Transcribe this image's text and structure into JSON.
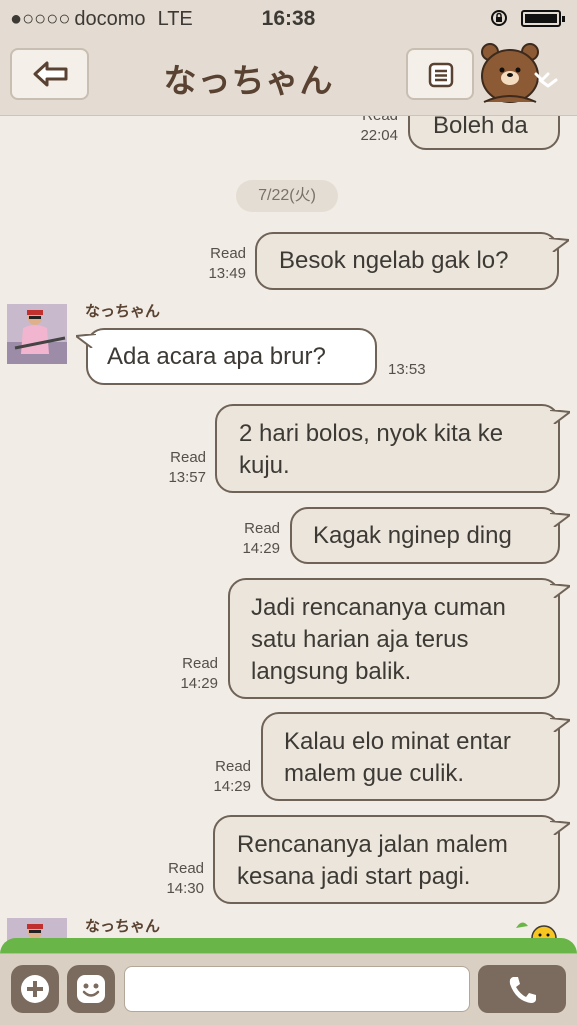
{
  "status_bar": {
    "signal": "●○○○○",
    "carrier": "docomo",
    "network": "LTE",
    "time": "16:38"
  },
  "header": {
    "title": "なっちゃん"
  },
  "messages": [
    {
      "dir": "out",
      "text": "Boleh da",
      "status": "Read",
      "time": "22:04"
    },
    {
      "date": "7/22(火)"
    },
    {
      "dir": "out",
      "text": "Besok ngelab gak lo?",
      "status": "Read",
      "time": "13:49"
    },
    {
      "dir": "in",
      "sender": "なっちゃん",
      "text": "Ada acara apa brur?",
      "time": "13:53"
    },
    {
      "dir": "out",
      "lines": [
        "2 hari bolos, nyok kita ke",
        "kuju."
      ],
      "status": "Read",
      "time": "13:57"
    },
    {
      "dir": "out",
      "text": "Kagak nginep ding",
      "status": "Read",
      "time": "14:29"
    },
    {
      "dir": "out",
      "lines": [
        "Jadi rencananya cuman",
        "satu harian aja terus",
        "langsung balik."
      ],
      "status": "Read",
      "time": "14:29"
    },
    {
      "dir": "out",
      "lines": [
        "Kalau elo minat entar",
        "malem gue culik."
      ],
      "status": "Read",
      "time": "14:29"
    },
    {
      "dir": "out",
      "lines": [
        "Rencananya jalan malem",
        "kesana jadi start pagi."
      ],
      "status": "Read",
      "time": "14:30"
    },
    {
      "dir": "in",
      "sender": "なっちゃん"
    }
  ],
  "input": {
    "placeholder": ""
  },
  "colors": {
    "background": "#f1ece5",
    "header": "#e4dcd2",
    "title": "#594231",
    "outgoing_bubble": "#ece5dc",
    "incoming_bubble": "#ffffff",
    "button": "#7b6a5e"
  }
}
